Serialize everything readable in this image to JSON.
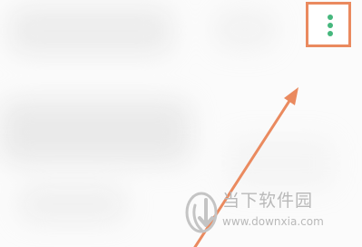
{
  "watermark": {
    "title": "当下软件园",
    "url": "www.downxia.com"
  },
  "menu": {
    "icon": "more-vertical-icon"
  },
  "annotation": {
    "highlight_color": "#ea8a5f",
    "dot_color": "#46b77d"
  }
}
